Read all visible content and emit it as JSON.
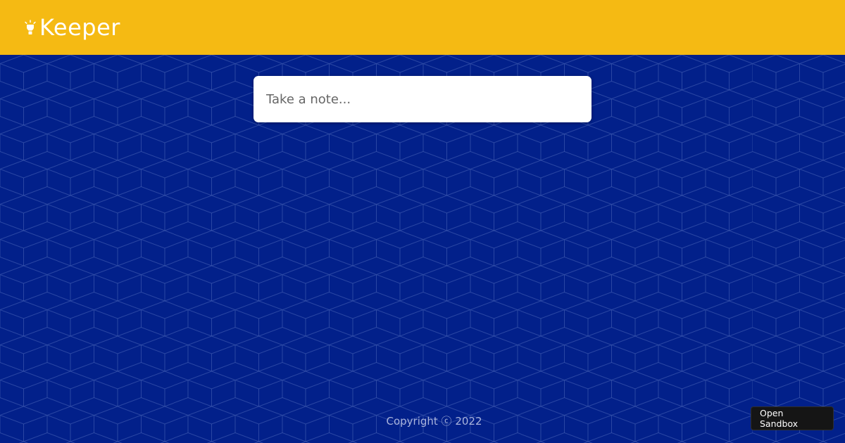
{
  "header": {
    "brand": "Keeper",
    "icon": "lightbulb-icon",
    "background_color": "#f5ba13"
  },
  "note_form": {
    "placeholder": "Take a note..."
  },
  "footer": {
    "copyright": "Copyright ⓒ 2022"
  },
  "sandbox": {
    "label": "Open Sandbox"
  },
  "colors": {
    "page_background": "#02208a",
    "accent": "#f5ba13"
  }
}
